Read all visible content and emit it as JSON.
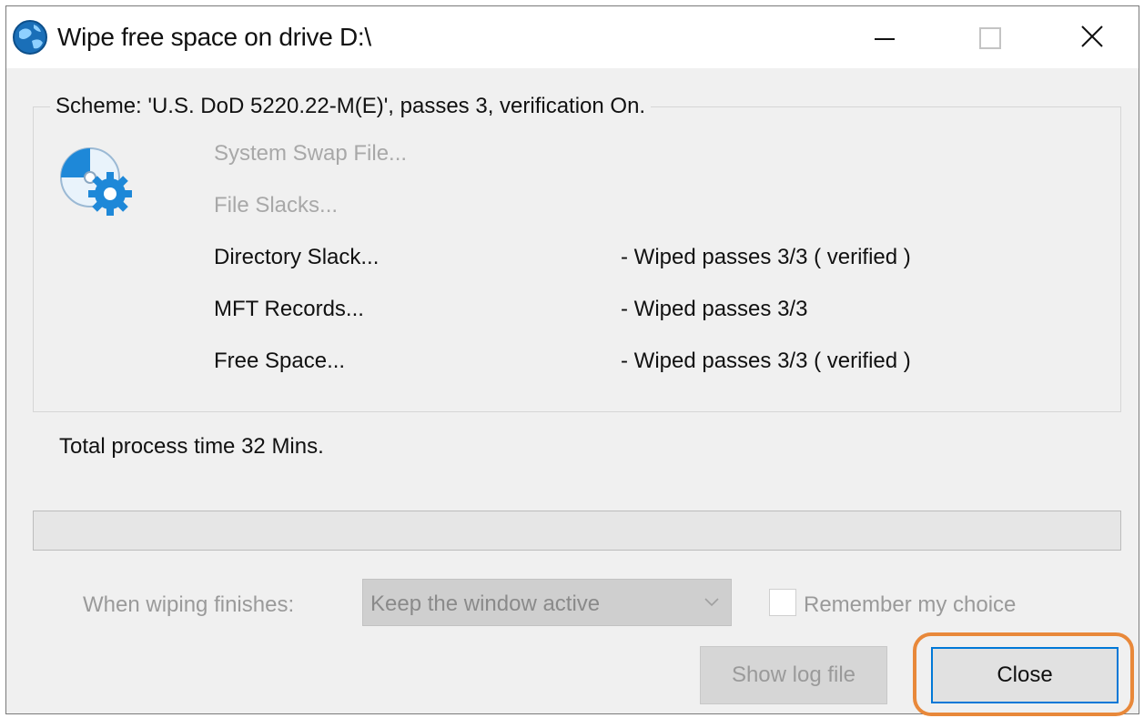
{
  "window": {
    "title": "Wipe free space on drive D:\\",
    "icon": "app-globe-icon"
  },
  "title_controls": {
    "minimize_icon": "minimize-icon",
    "maximize_icon": "maximize-icon",
    "close_icon": "close-icon"
  },
  "scheme": {
    "label": "Scheme: 'U.S. DoD 5220.22-M(E)', passes 3, verification On."
  },
  "items": [
    {
      "name": "System Swap File...",
      "status": "",
      "enabled": false
    },
    {
      "name": "File Slacks...",
      "status": "",
      "enabled": false
    },
    {
      "name": "Directory Slack...",
      "status": "- Wiped passes 3/3 ( verified )",
      "enabled": true
    },
    {
      "name": "MFT Records...",
      "status": "- Wiped passes 3/3",
      "enabled": true
    },
    {
      "name": "Free Space...",
      "status": "- Wiped passes 3/3 ( verified )",
      "enabled": true
    }
  ],
  "total_time": "Total process time 32 Mins.",
  "progress": {
    "value": 0
  },
  "finish": {
    "label": "When wiping finishes:",
    "selected": "Keep the window active",
    "remember_label": "Remember my choice",
    "remember_checked": false
  },
  "buttons": {
    "show_log": "Show log file",
    "close": "Close"
  },
  "colors": {
    "highlight": "#e8883a",
    "focus_border": "#0078d7",
    "icon_blue": "#1e88d8"
  }
}
